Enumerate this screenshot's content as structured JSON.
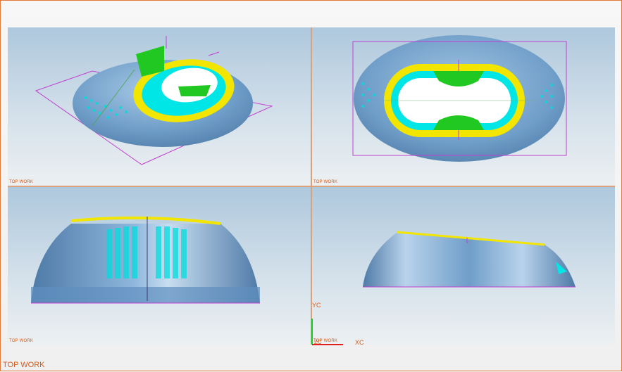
{
  "window": {
    "label": "TOP WORK"
  },
  "viewports": [
    {
      "id": "iso",
      "label": "TOP WORK"
    },
    {
      "id": "top",
      "label": "TOP WORK"
    },
    {
      "id": "front",
      "label": "TOP WORK"
    },
    {
      "id": "right",
      "label": "TOP WORK"
    }
  ],
  "axes": {
    "y_label": "YC",
    "x_label": "XC",
    "origin_label": "ZC"
  },
  "colors": {
    "frame": "#e07a3a",
    "label": "#d35b1c",
    "body": "#6f9ec9",
    "rim": "#f2e600",
    "cavity": "#00e6e6",
    "pocket": "#22c822",
    "bbox": "#c040d0"
  }
}
